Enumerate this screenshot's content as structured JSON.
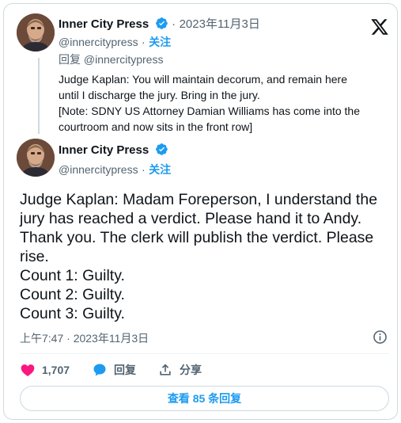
{
  "parent_tweet": {
    "author_name": "Inner City Press",
    "handle": "@innercitypress",
    "separator": "·",
    "follow_label": "关注",
    "date": "2023年11月3日",
    "reply_to": "回复 @innercitypress",
    "text_lines": [
      "Judge Kaplan: You will maintain decorum, and remain here",
      "until I discharge the jury. Bring in the jury.",
      "[Note: SDNY US Attorney Damian Williams has come into the",
      "courtroom and now sits in the front row]"
    ]
  },
  "main_tweet": {
    "author_name": "Inner City Press",
    "handle": "@innercitypress",
    "separator": "·",
    "follow_label": "关注",
    "text_lines": [
      "Judge Kaplan: Madam Foreperson, I understand the",
      "jury has reached a verdict. Please hand it to Andy.",
      "Thank you. The clerk will publish the verdict. Please",
      "rise.",
      "Count 1: Guilty.",
      "Count 2: Guilty.",
      "Count 3: Guilty."
    ],
    "timestamp": "上午7:47 · 2023年11月3日"
  },
  "actions": {
    "likes": "1,707",
    "reply_label": "回复",
    "share_label": "分享"
  },
  "replies_button": "查看 85 条回复",
  "icons": {
    "verified": "verified-badge-icon",
    "x_logo": "x-logo-icon",
    "info": "info-icon",
    "like": "heart-icon",
    "reply": "speech-bubble-icon",
    "share": "share-upload-icon"
  },
  "colors": {
    "accent": "#1d9bf0",
    "like": "#f91880",
    "muted": "#536471"
  }
}
